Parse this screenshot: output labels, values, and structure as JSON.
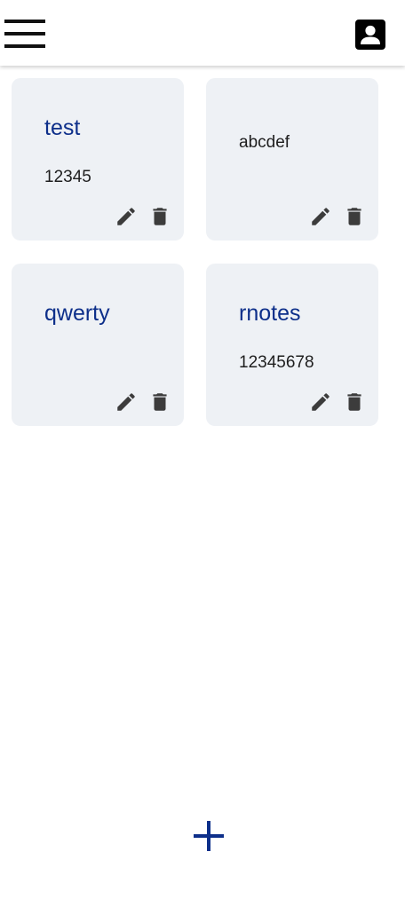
{
  "appbar": {
    "menu_icon": "hamburger-menu-icon",
    "account_icon": "account-box-icon"
  },
  "notes": [
    {
      "title": "test",
      "body": "12345"
    },
    {
      "title": "",
      "body": "abcdef"
    },
    {
      "title": "qwerty",
      "body": ""
    },
    {
      "title": "rnotes",
      "body": "12345678"
    }
  ],
  "actions": {
    "edit_icon": "pencil-icon",
    "delete_icon": "trash-icon"
  },
  "fab": {
    "icon": "plus-icon"
  },
  "colors": {
    "accent": "#0d2f8a",
    "card_background": "#eef1f5",
    "icon": "#3c3c3c"
  }
}
